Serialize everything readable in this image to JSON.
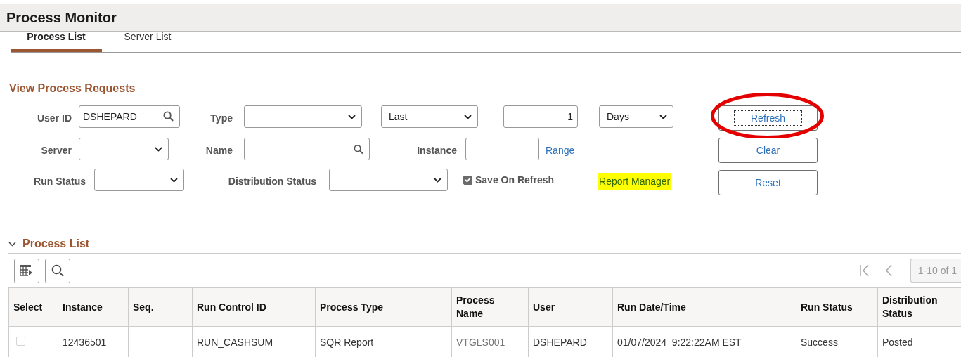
{
  "title": "Process Monitor",
  "tabs": [
    {
      "label": "Process List",
      "selected": true
    },
    {
      "label": "Server List",
      "selected": false
    }
  ],
  "view_process_requests": {
    "heading": "View Process Requests",
    "user_id": {
      "label": "User ID",
      "value": "DSHEPARD"
    },
    "type": {
      "label": "Type"
    },
    "period": {
      "value": "Last"
    },
    "amount": {
      "value": "1"
    },
    "unit": {
      "value": "Days"
    },
    "server": {
      "label": "Server"
    },
    "name": {
      "label": "Name"
    },
    "instance": {
      "label": "Instance"
    },
    "range_link": "Range",
    "run_status": {
      "label": "Run Status"
    },
    "distribution_status": {
      "label": "Distribution Status"
    },
    "save_on_refresh": {
      "label": "Save On Refresh",
      "checked": true
    },
    "report_manager": {
      "label": "Report Manager",
      "highlighted": true
    },
    "buttons": [
      {
        "label": "Refresh",
        "focused": true,
        "circled": true
      },
      {
        "label": "Clear",
        "focused": false,
        "circled": false
      },
      {
        "label": "Reset",
        "focused": false,
        "circled": false
      }
    ]
  },
  "process_list": {
    "title": "Process List",
    "expanded": true,
    "pager": "1-10 of 1",
    "columns": [
      "Select",
      "Instance",
      "Seq.",
      "Run Control ID",
      "Process Type",
      "Process Name",
      "User",
      "Run Date/Time",
      "Run Status",
      "Distribution Status"
    ],
    "rows": [
      {
        "checked": false,
        "disabled": true,
        "instance": "12436501",
        "run_control_id": "RUN_CASHSUM",
        "process_type": "SQR Report",
        "process_name": "VTGLS001",
        "user": "DSHEPARD",
        "run_date_time": "01/07/2024  9:22:22AM EST",
        "run_status": "Success",
        "distribution_status": "Posted"
      }
    ]
  }
}
